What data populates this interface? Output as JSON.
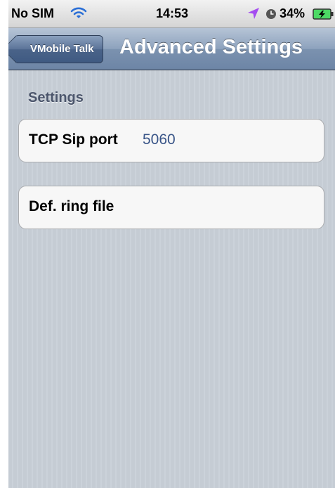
{
  "status_bar": {
    "carrier": "No SIM",
    "time": "14:53",
    "battery_percent": "34%",
    "icons": [
      "wifi-icon",
      "location-arrow-icon",
      "clock-icon",
      "battery-charging-icon"
    ]
  },
  "nav": {
    "back_label": "VMobile Talk",
    "title": "Advanced Settings"
  },
  "section": {
    "header": "Settings"
  },
  "settings": [
    {
      "label": "TCP Sip port",
      "value": "5060"
    },
    {
      "label": "Def. ring file",
      "value": ""
    }
  ],
  "colors": {
    "nav_bar": "#7b92af",
    "value_text": "#385487",
    "section_header": "#4c566c",
    "location_icon": "#a44cf0",
    "battery_fill": "#4cd964"
  }
}
